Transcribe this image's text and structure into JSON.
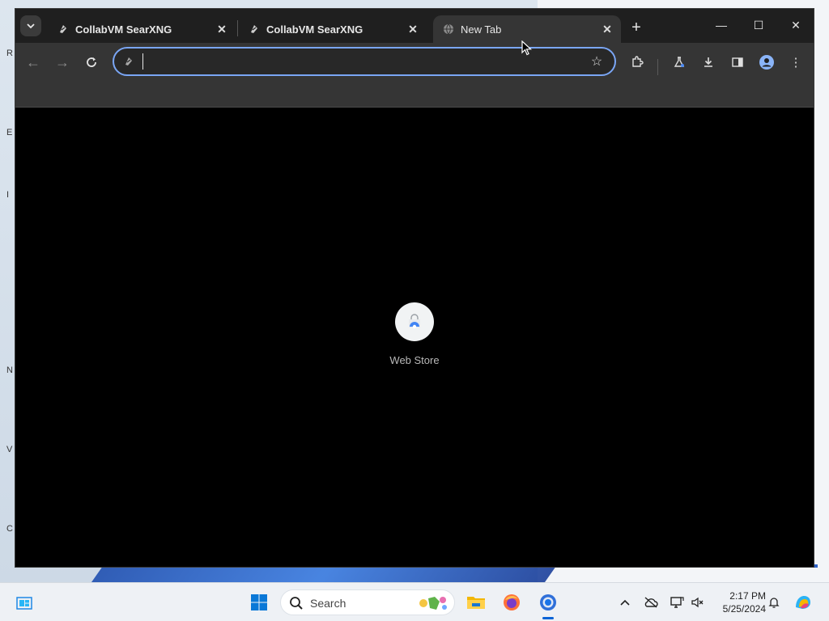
{
  "desktop": {
    "glyphs": [
      "R",
      "E",
      "I",
      "N",
      "V",
      "C"
    ]
  },
  "browser": {
    "tab_menu_icon": "chevron-down-icon",
    "tabs": [
      {
        "title": "CollabVM SearXNG",
        "favicon": "searxng-icon",
        "active": false
      },
      {
        "title": "CollabVM SearXNG",
        "favicon": "searxng-icon",
        "active": false
      },
      {
        "title": "New Tab",
        "favicon": "globe-icon",
        "active": true
      }
    ],
    "window_controls": {
      "minimize": "—",
      "maximize": "☐",
      "close": "✕"
    },
    "address_bar": {
      "value": "",
      "placeholder": ""
    },
    "accent_color": "#7aa6f5",
    "shortcuts": [
      {
        "label": "Web Store",
        "icon": "web-store-icon"
      }
    ]
  },
  "taskbar": {
    "search_label": "Search",
    "apps": [
      "widgets-icon",
      "windows-start-icon",
      "file-explorer-icon",
      "firefox-icon",
      "chrome-icon",
      "copilot-icon"
    ],
    "clock": {
      "time": "2:17 PM",
      "date": "5/25/2024"
    }
  }
}
